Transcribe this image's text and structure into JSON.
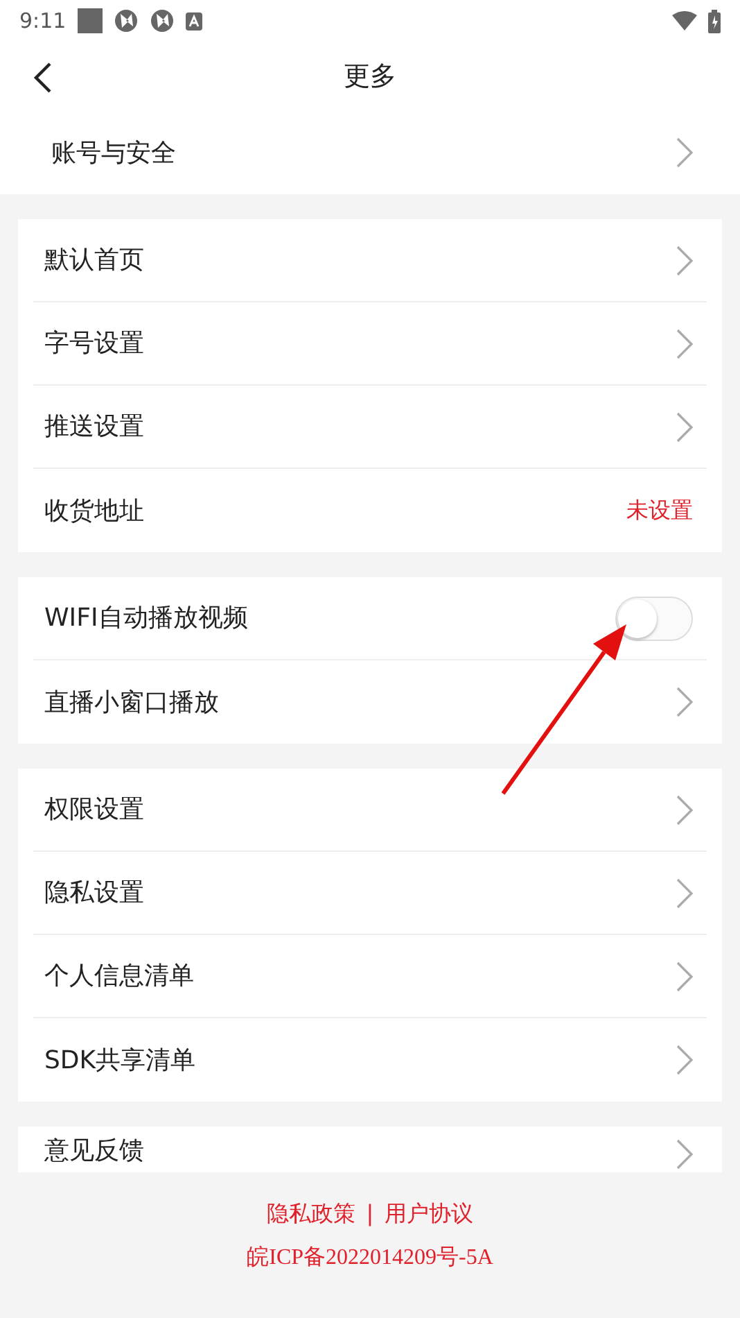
{
  "status_bar": {
    "time": "9:11"
  },
  "header": {
    "title": "更多"
  },
  "account": {
    "label": "账号与安全"
  },
  "sections": [
    {
      "rows": [
        {
          "kind": "link",
          "label": "默认首页"
        },
        {
          "kind": "link",
          "label": "字号设置"
        },
        {
          "kind": "link",
          "label": "推送设置"
        },
        {
          "kind": "value",
          "label": "收货地址",
          "value": "未设置"
        }
      ]
    },
    {
      "rows": [
        {
          "kind": "toggle",
          "label": "WIFI自动播放视频",
          "on": false
        },
        {
          "kind": "link",
          "label": "直播小窗口播放"
        }
      ]
    },
    {
      "rows": [
        {
          "kind": "link",
          "label": "权限设置"
        },
        {
          "kind": "link",
          "label": "隐私设置"
        },
        {
          "kind": "link",
          "label": "个人信息清单"
        },
        {
          "kind": "link",
          "label": "SDK共享清单"
        }
      ]
    },
    {
      "rows": [
        {
          "kind": "link",
          "label": "意见反馈"
        }
      ]
    }
  ],
  "footer": {
    "links": [
      "隐私政策",
      "用户协议"
    ],
    "separator": "|",
    "icp": "皖ICP备2022014209号-5A"
  }
}
